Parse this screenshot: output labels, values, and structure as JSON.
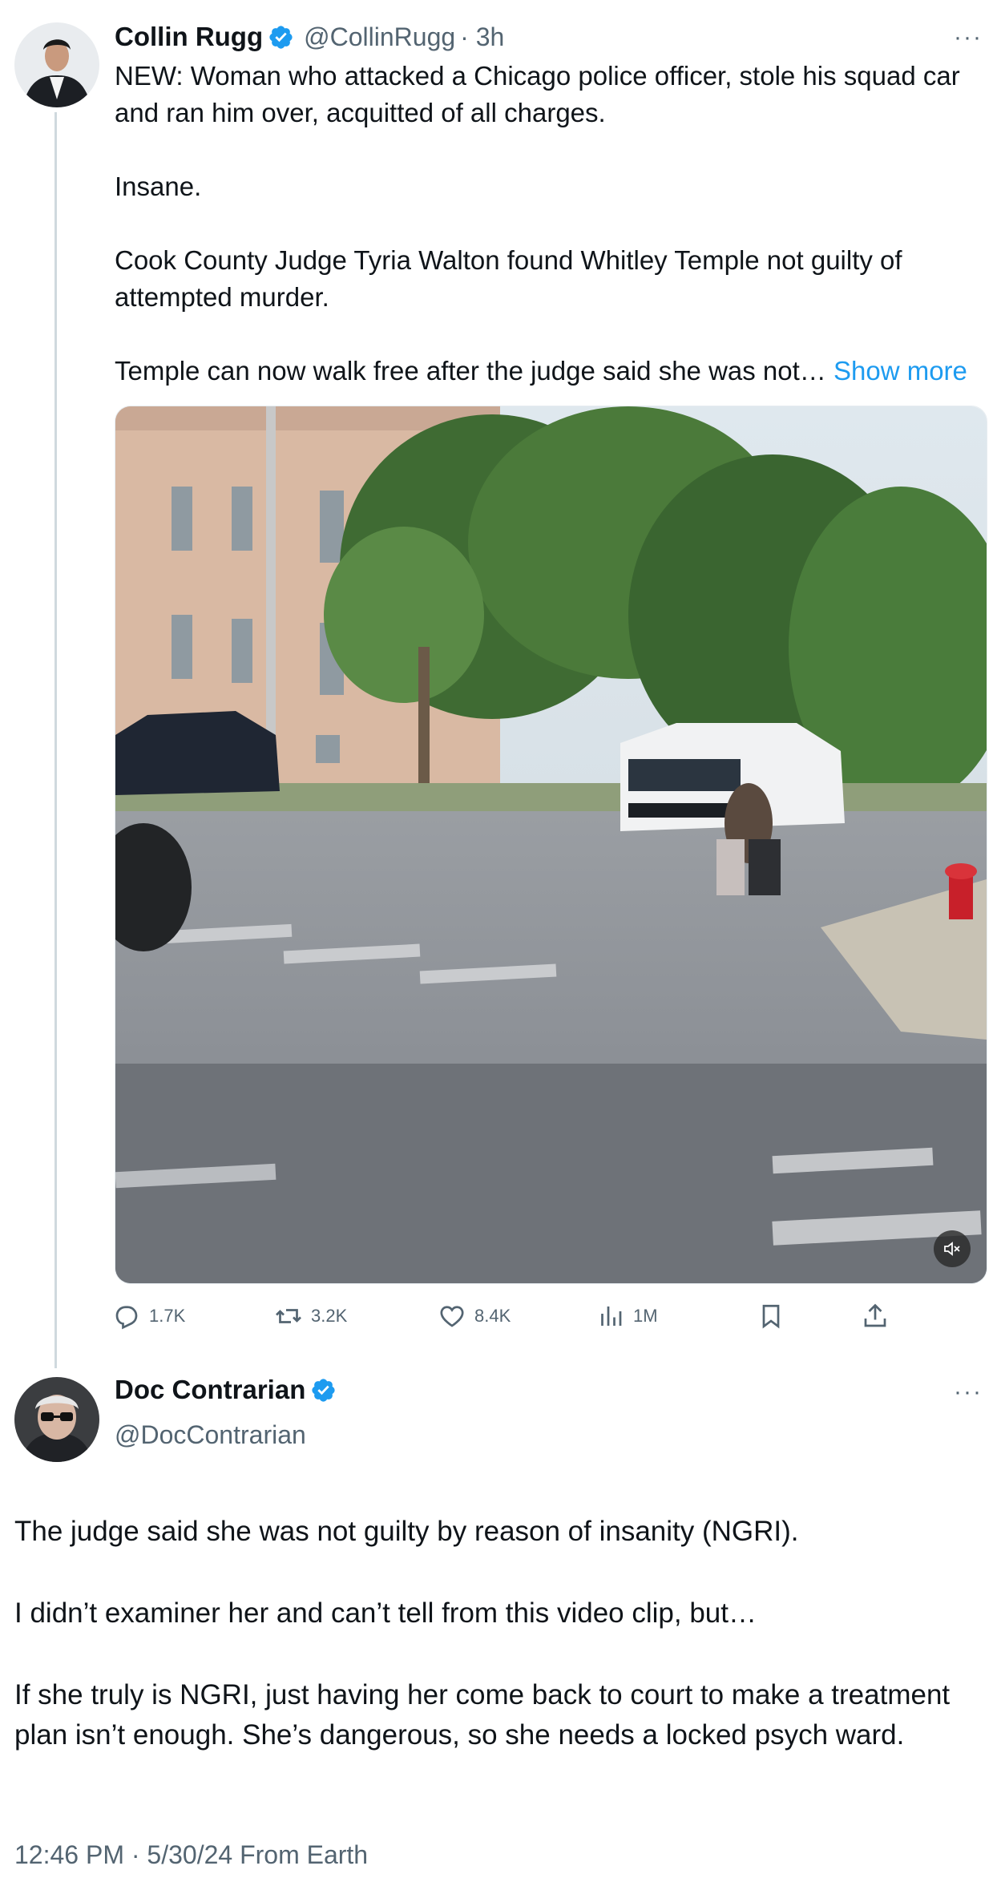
{
  "tweet": {
    "author_name": "Collin Rugg",
    "handle": "@CollinRugg",
    "time": "· 3h",
    "more": "···",
    "paragraphs": [
      "NEW: Woman who attacked a Chicago police officer, stole his squad car and ran him over, acquitted of all charges.",
      "Insane.",
      "Cook County Judge Tyria Walton found Whitley Temple not guilty of attempted murder.",
      "Temple can now walk free after the judge said she was not…"
    ],
    "show_more": "Show more",
    "stats": {
      "replies": "1.7K",
      "reposts": "3.2K",
      "likes": "8.4K",
      "views": "1M"
    }
  },
  "reply": {
    "author_name": "Doc Contrarian",
    "handle": "@DocContrarian",
    "more": "···",
    "paragraphs": [
      "The judge said she was not guilty by reason of insanity (NGRI).",
      "I didn’t examiner her and can’t tell from this video clip, but…",
      "If she truly is NGRI, just having her come back to court to make a treatment plan isn’t enough. She’s dangerous, so she needs a locked psych ward."
    ],
    "timestamp": "12:46 PM · 5/30/24 From Earth"
  },
  "icons": [
    "avatar",
    "verified-badge-icon",
    "more-icon",
    "mute-icon",
    "reply-icon",
    "repost-icon",
    "like-icon",
    "views-icon",
    "bookmark-icon",
    "share-icon"
  ],
  "colors": {
    "accent": "#1d9bf0",
    "secondary_text": "#536471",
    "text": "#0f1419"
  }
}
